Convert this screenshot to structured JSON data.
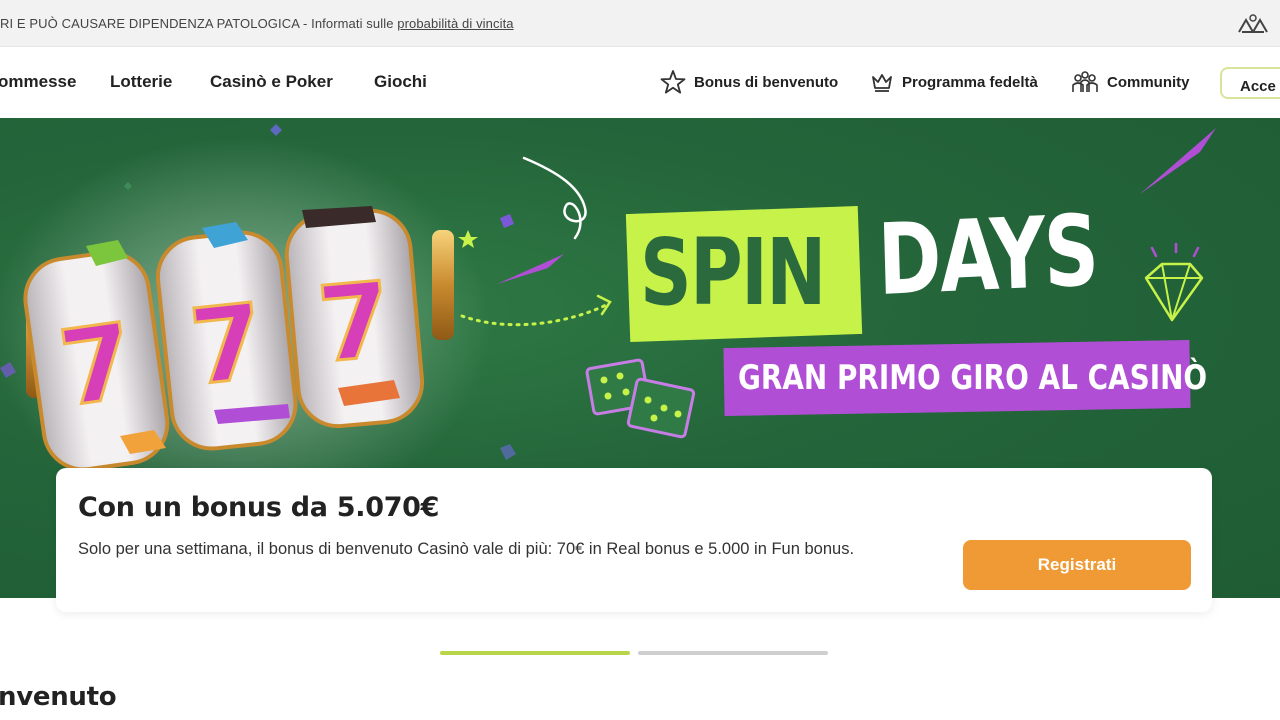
{
  "warning_bar": {
    "text": "RI E PUÒ CAUSARE DIPENDENZA PATOLOGICA - Informati sulle ",
    "link": "probabilità di vincita"
  },
  "nav": {
    "items": [
      {
        "label": "ommesse"
      },
      {
        "label": "Lotterie"
      },
      {
        "label": "Casinò e Poker"
      },
      {
        "label": "Giochi"
      }
    ],
    "right_items": [
      {
        "label": "Bonus di benvenuto",
        "icon": "star-icon"
      },
      {
        "label": "Programma fedeltà",
        "icon": "crown-icon"
      },
      {
        "label": "Community",
        "icon": "community-icon"
      }
    ],
    "login_label": "Acce"
  },
  "hero": {
    "headline_part1": "SPIN",
    "headline_part2": "DAYS",
    "subheadline": "GRAN PRIMO GIRO AL CASINÒ",
    "reel_symbol": "7",
    "colors": {
      "background": "#24653a",
      "lime": "#c6f24a",
      "purple": "#b04fd6",
      "reel_seven": "#d63fb8"
    }
  },
  "bonus_card": {
    "title": "Con un bonus da 5.070€",
    "description": "Solo per una settimana, il bonus di benvenuto Casinò vale di più: 70€ in Real bonus e 5.000 in Fun bonus.",
    "cta_label": "Registrati",
    "cta_color": "#ef9a35"
  },
  "carousel": {
    "slide_count": 2,
    "active_index": 0
  },
  "section": {
    "title": "nvenuto"
  }
}
